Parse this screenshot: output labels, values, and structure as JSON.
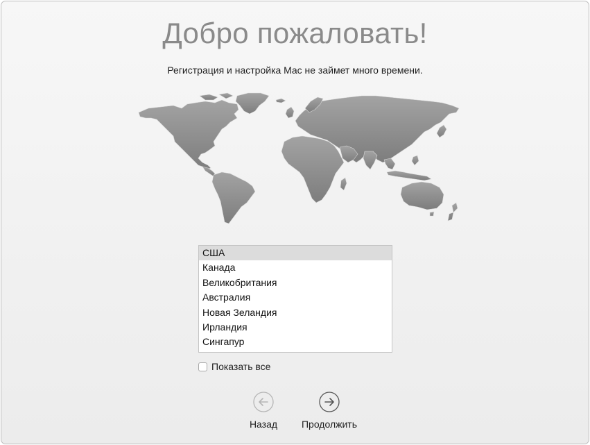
{
  "header": {
    "title": "Добро пожаловать!",
    "subtitle": "Регистрация и настройка Mac не займет много времени."
  },
  "countries": {
    "items": [
      "США",
      "Канада",
      "Великобритания",
      "Австралия",
      "Новая Зеландия",
      "Ирландия",
      "Сингапур"
    ],
    "selected": "США"
  },
  "show_all": {
    "label": "Показать все",
    "checked": false
  },
  "nav": {
    "back_label": "Назад",
    "back_enabled": false,
    "continue_label": "Продолжить",
    "continue_enabled": true
  },
  "colors": {
    "map_fill": "#8f8f8f",
    "disabled": "#b5b5b5",
    "enabled": "#555555"
  },
  "icons": {
    "back": "arrow-left-circle-icon",
    "continue": "arrow-right-circle-icon",
    "map": "world-map-icon"
  }
}
